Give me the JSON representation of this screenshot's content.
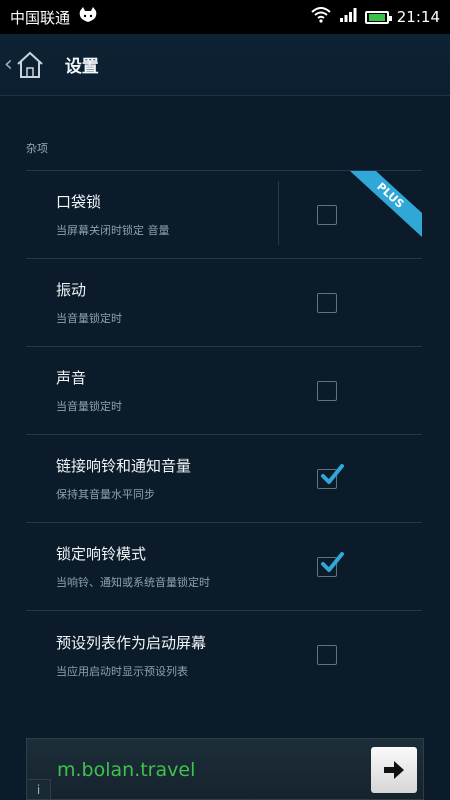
{
  "status_bar": {
    "carrier": "中国联通",
    "time": "21:14",
    "icons": [
      "cat-icon",
      "wifi-icon",
      "signal-icon",
      "battery-icon"
    ]
  },
  "header": {
    "title": "设置",
    "back_icon": "chevron-left-icon",
    "home_icon": "home-icon"
  },
  "section": {
    "label": "杂项"
  },
  "settings": [
    {
      "title": "口袋锁",
      "subtitle": "当屏幕关闭时锁定 音量",
      "checked": false,
      "plus": true
    },
    {
      "title": "振动",
      "subtitle": "当音量锁定时",
      "checked": false
    },
    {
      "title": "声音",
      "subtitle": "当音量锁定时",
      "checked": false
    },
    {
      "title": "链接响铃和通知音量",
      "subtitle": "保持其音量水平同步",
      "checked": true
    },
    {
      "title": "锁定响铃模式",
      "subtitle": "当响铃、通知或系统音量锁定时",
      "checked": true
    },
    {
      "title": "预设列表作为启动屏幕",
      "subtitle": "当应用启动时显示预设列表",
      "checked": false
    }
  ],
  "badge": {
    "plus_label": "PLUS"
  },
  "ad": {
    "text": "m.bolan.travel",
    "info_label": "i"
  },
  "colors": {
    "accent_check": "#2fa8d8",
    "ad_text": "#3ec14d"
  }
}
